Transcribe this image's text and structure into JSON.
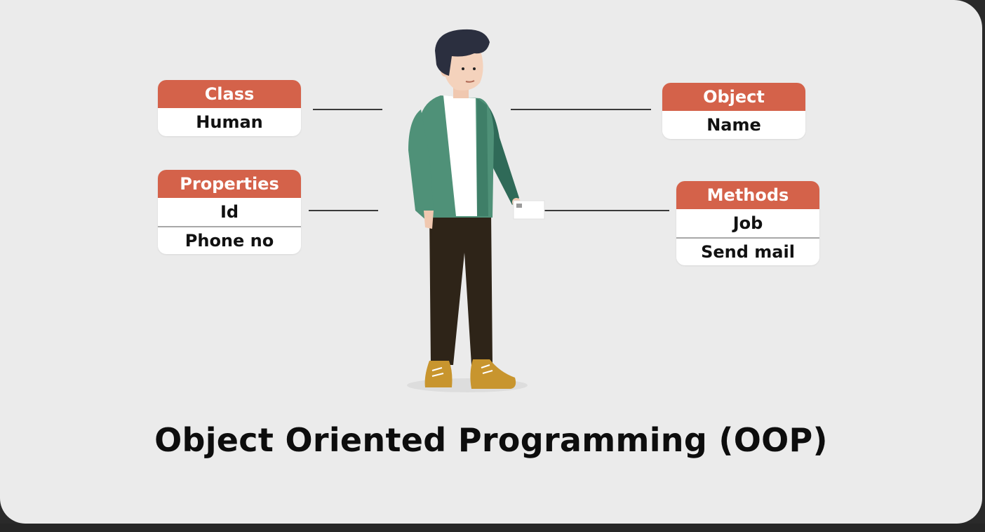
{
  "title": "Object Oriented Programming (OOP)",
  "boxes": {
    "class": {
      "header": "Class",
      "rows": [
        "Human"
      ]
    },
    "properties": {
      "header": "Properties",
      "rows": [
        "Id",
        "Phone no"
      ]
    },
    "object": {
      "header": "Object",
      "rows": [
        "Name"
      ]
    },
    "methods": {
      "header": "Methods",
      "rows": [
        "Job",
        "Send mail"
      ]
    }
  },
  "colors": {
    "header": "#d4624a",
    "background": "#ebebeb",
    "jacket": "#4f9178",
    "pants": "#2e2418",
    "shoes": "#c8952e",
    "hair": "#2b2f3f"
  }
}
